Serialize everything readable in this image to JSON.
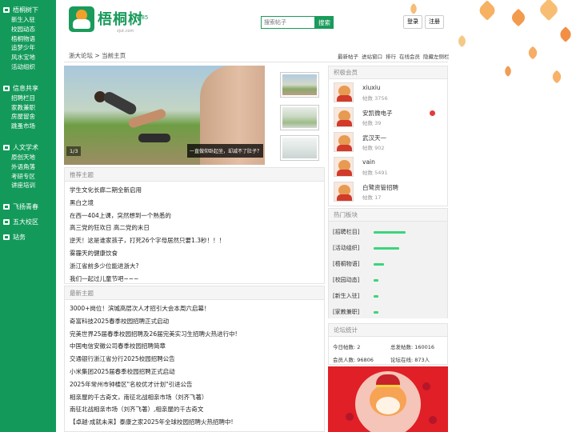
{
  "sidebar": {
    "groups": [
      {
        "title": "梧桐树下",
        "items": [
          "新生入驻",
          "校园动态",
          "梧桐物语",
          "追梦少年",
          "风水宝地",
          "活动组织"
        ]
      },
      {
        "title": "信息共享",
        "items": [
          "招聘栏目",
          "家教兼职",
          "房屋留舍",
          "跳蚤市场"
        ]
      },
      {
        "title": "人文学术",
        "items": [
          "原创天地",
          "外语角落",
          "考研专区",
          "讲座培训"
        ]
      },
      {
        "title": "飞扬青春",
        "items": []
      },
      {
        "title": "五大校区",
        "items": []
      },
      {
        "title": "站务",
        "items": []
      }
    ]
  },
  "header": {
    "logo_name": "梧桐树",
    "logo_num": "885",
    "logo_sub": "zjut.com",
    "search_placeholder": "搜索帖子",
    "search_button": "搜索",
    "login": "登录",
    "register": "注册"
  },
  "breadcrumb": {
    "forum": "浙大论坛",
    "sep": ">",
    "current": "当前主页"
  },
  "toplinks": [
    "最新帖子",
    "进站窗口",
    "排行",
    "在线会员",
    "隐藏左侧栏"
  ],
  "slider": {
    "counter": "1/3",
    "caption": "一直做仰卧起坐，却减不了肚子？"
  },
  "recommended": {
    "title": "推荐主题",
    "items": [
      "学生文化长廊二期全新启用",
      "黑白之境",
      "在西一404上课，突然想到一个熟悉的",
      "高三党的狂欢日 高二党的末日",
      "逆天！这是谁家孩子，打死26个字母居然只要1.3秒！！！",
      "雾霾天的健康饮食",
      "浙江省前多少位能进浙大?",
      "我们一起过儿童节吧~~~"
    ]
  },
  "latest": {
    "title": "最新主题",
    "items": [
      "3000+岗位！滨城高层次人才招引大会本周六启幕！",
      "奇富科技2025春季校园招聘正式启动",
      "完美世界25届春季校园招聘及26届完美实习生招聘火热进行中!",
      "中国电信安徽公司春季校园招聘简章",
      "交通银行浙江省分行2025校园招聘公告",
      "小米集团2025届春季校园招聘正式启动",
      "2025年常州市钟楼区\"名校优才计划\"引进公告",
      "相亲屋的千古奇文，南征北战相亲市场（刘齐飞著）",
      "南征北战相亲市场（刘齐飞著）,相亲屋的千古奇文",
      "【卓越·成就未来】泰康之家2025年全球校园招聘火热招聘中!"
    ]
  },
  "members": {
    "title": "积极会员",
    "list": [
      {
        "name": "xiuxiu",
        "posts": "帖数 3756"
      },
      {
        "name": "安凯微电子",
        "posts": "帖数 39",
        "flag": true
      },
      {
        "name": "武汉天一",
        "posts": "帖数 902"
      },
      {
        "name": "vain",
        "posts": "帖数 5491"
      },
      {
        "name": "白鹭资管招聘",
        "posts": "帖数 17"
      }
    ]
  },
  "hot_boards": {
    "title": "热门板块",
    "list": [
      {
        "label": "[招聘栏目]",
        "level": 1.0
      },
      {
        "label": "[活动组织]",
        "level": 0.8
      },
      {
        "label": "[梧桐物语]",
        "level": 0.32
      },
      {
        "label": "[校园动态]",
        "level": 0.14
      },
      {
        "label": "[新生入驻]",
        "level": 0.14
      },
      {
        "label": "[家教兼职]",
        "level": 0.14
      }
    ]
  },
  "forum_stats": {
    "title": "论坛统计",
    "today_posts": "今日帖数: 2",
    "total_posts": "总发帖数: 160016",
    "members": "会员人数: 96806",
    "online": "论坛在线: 873人"
  },
  "colors": {
    "brand": "#139a5a",
    "hot_bar": "#3bd57c",
    "promo": "#e01f26"
  },
  "icons": {
    "sidebar": "folder-icon",
    "promo": "lucky-cat-image"
  }
}
